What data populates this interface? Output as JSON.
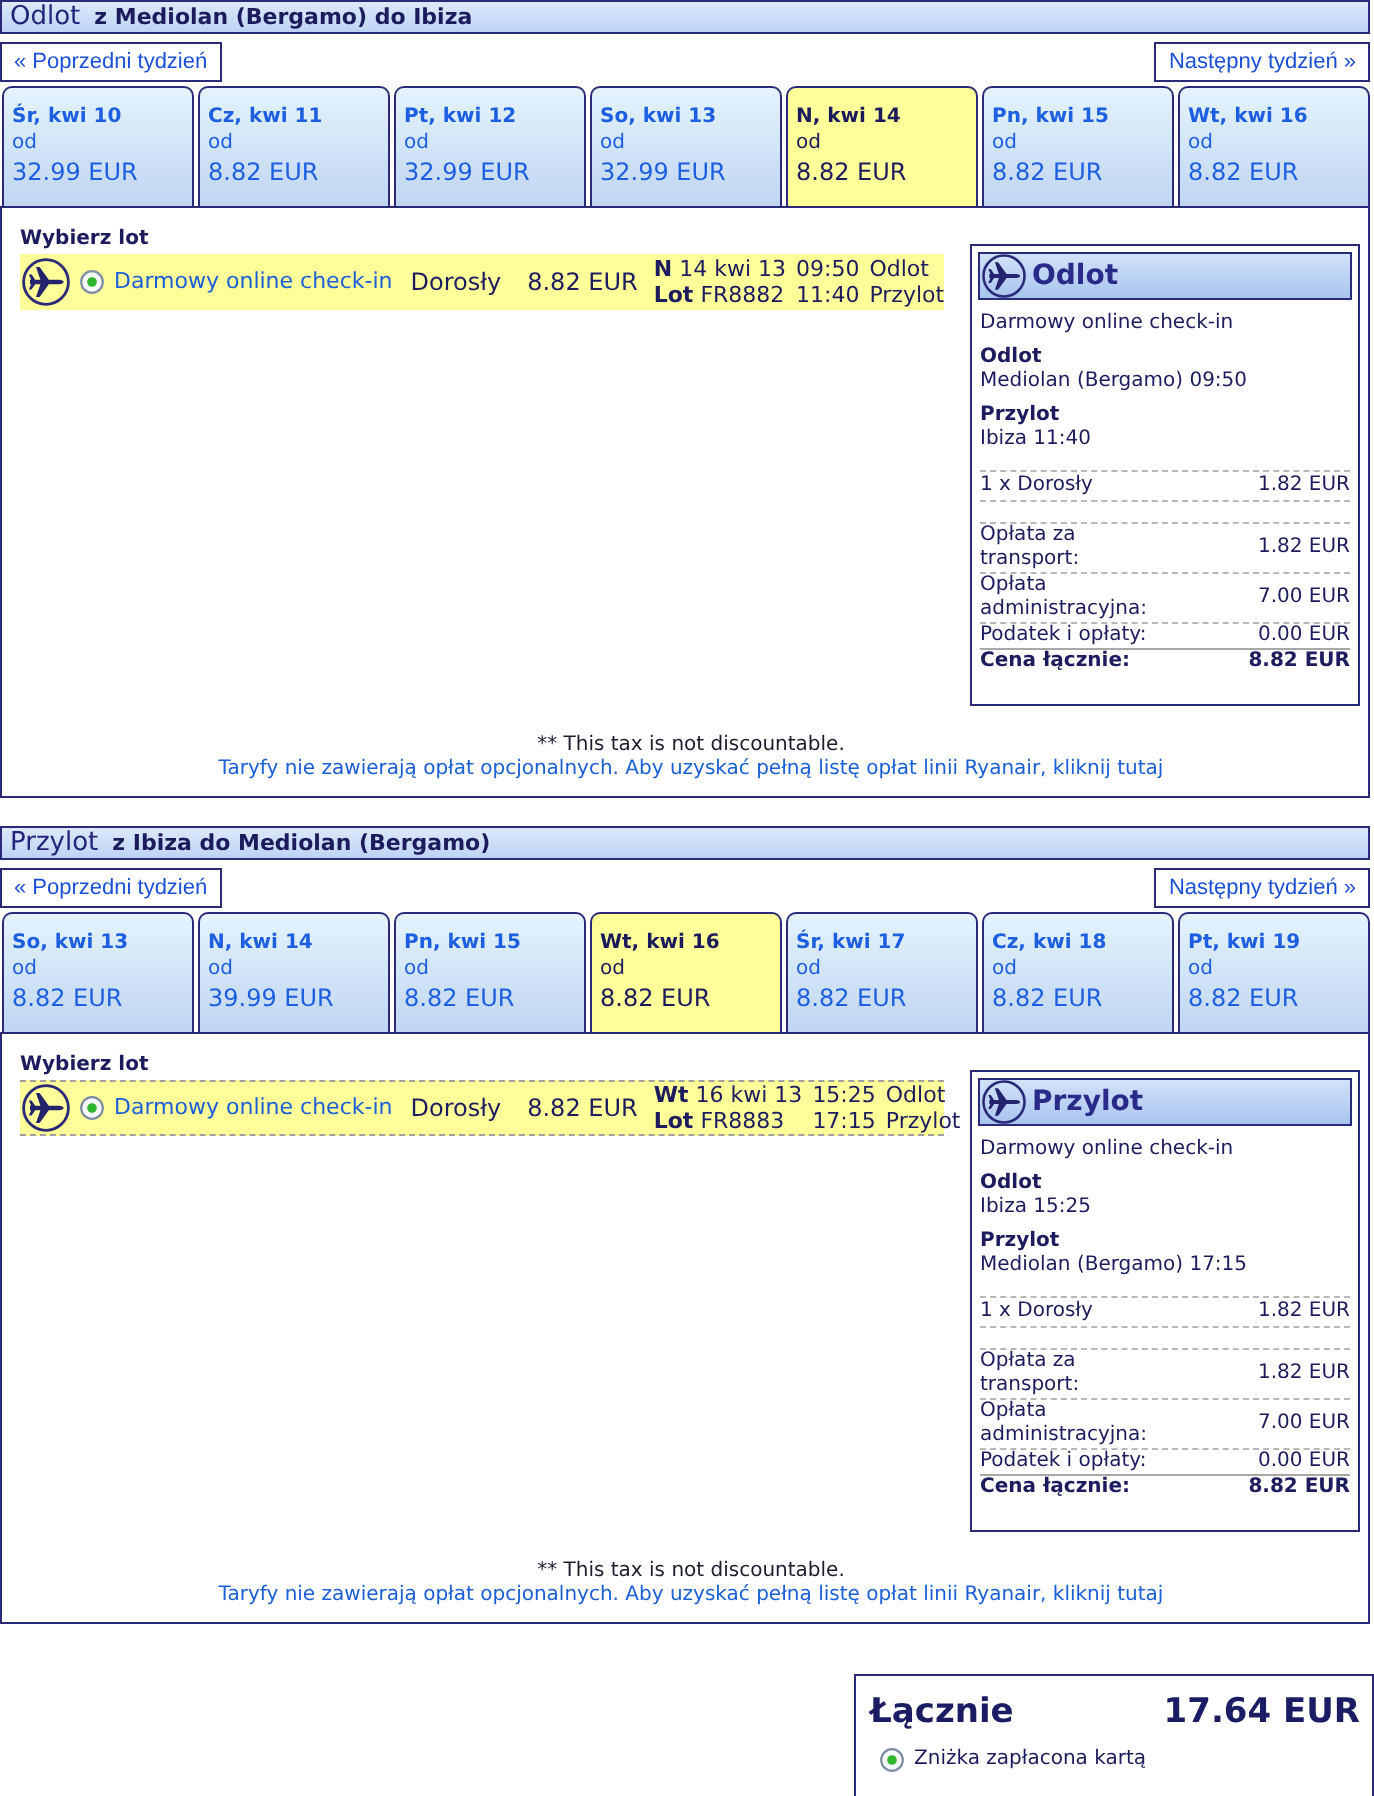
{
  "sections": [
    {
      "title": "Odlot",
      "route": "z Mediolan (Bergamo) do Ibiza",
      "prev_week": "« Poprzedni tydzień",
      "next_week": "Następny tydzień »",
      "days": [
        {
          "day": "Śr, kwi 10",
          "from": "od",
          "price": "32.99 EUR",
          "selected": false
        },
        {
          "day": "Cz, kwi 11",
          "from": "od",
          "price": "8.82 EUR",
          "selected": false
        },
        {
          "day": "Pt, kwi 12",
          "from": "od",
          "price": "32.99 EUR",
          "selected": false
        },
        {
          "day": "So, kwi 13",
          "from": "od",
          "price": "32.99 EUR",
          "selected": false
        },
        {
          "day": "N, kwi 14",
          "from": "od",
          "price": "8.82 EUR",
          "selected": true
        },
        {
          "day": "Pn, kwi 15",
          "from": "od",
          "price": "8.82 EUR",
          "selected": false
        },
        {
          "day": "Wt, kwi 16",
          "from": "od",
          "price": "8.82 EUR",
          "selected": false
        }
      ],
      "choose_label": "Wybierz lot",
      "flights": [
        {
          "selected": true,
          "focused": false,
          "fare_name": "Darmowy online check-in",
          "passenger": "Dorosły",
          "price": "8.82 EUR",
          "day": "N",
          "date": "14 kwi 13",
          "depart_time": "09:50",
          "depart_label": "Odlot",
          "flight_label": "Lot",
          "flight_no": "FR8882",
          "arrive_time": "11:40",
          "arrive_label": "Przylot"
        }
      ],
      "summary": {
        "title": "Odlot",
        "fare_name": "Darmowy online check-in",
        "depart_heading": "Odlot",
        "depart_value": "Mediolan (Bergamo) 09:50",
        "arrive_heading": "Przylot",
        "arrive_value": "Ibiza 11:40",
        "passenger_line": {
          "label": "1 x Dorosły",
          "amount": "1.82 EUR"
        },
        "fees": [
          {
            "label": "Opłata za transport:",
            "amount": "1.82 EUR"
          },
          {
            "label": "Opłata administracyjna:",
            "amount": "7.00 EUR"
          },
          {
            "label": "Podatek i opłaty:",
            "amount": "0.00 EUR"
          }
        ],
        "total_label": "Cena łącznie:",
        "total": "8.82 EUR"
      },
      "tax_note": "** This tax is not discountable.",
      "fees_link": "Taryfy nie zawierają opłat opcjonalnych. Aby uzyskać pełną listę opłat linii Ryanair, kliknij tutaj"
    },
    {
      "title": "Przylot",
      "route": "z Ibiza do Mediolan (Bergamo)",
      "prev_week": "« Poprzedni tydzień",
      "next_week": "Następny tydzień »",
      "days": [
        {
          "day": "So, kwi 13",
          "from": "od",
          "price": "8.82 EUR",
          "selected": false
        },
        {
          "day": "N, kwi 14",
          "from": "od",
          "price": "39.99 EUR",
          "selected": false
        },
        {
          "day": "Pn, kwi 15",
          "from": "od",
          "price": "8.82 EUR",
          "selected": false
        },
        {
          "day": "Wt, kwi 16",
          "from": "od",
          "price": "8.82 EUR",
          "selected": true
        },
        {
          "day": "Śr, kwi 17",
          "from": "od",
          "price": "8.82 EUR",
          "selected": false
        },
        {
          "day": "Cz, kwi 18",
          "from": "od",
          "price": "8.82 EUR",
          "selected": false
        },
        {
          "day": "Pt, kwi 19",
          "from": "od",
          "price": "8.82 EUR",
          "selected": false
        }
      ],
      "choose_label": "Wybierz lot",
      "flights": [
        {
          "selected": true,
          "focused": true,
          "fare_name": "Darmowy online check-in",
          "passenger": "Dorosły",
          "price": "8.82 EUR",
          "day": "Wt",
          "date": "16 kwi 13",
          "depart_time": "15:25",
          "depart_label": "Odlot",
          "flight_label": "Lot",
          "flight_no": "FR8883",
          "arrive_time": "17:15",
          "arrive_label": "Przylot"
        }
      ],
      "summary": {
        "title": "Przylot",
        "fare_name": "Darmowy online check-in",
        "depart_heading": "Odlot",
        "depart_value": "Ibiza 15:25",
        "arrive_heading": "Przylot",
        "arrive_value": "Mediolan (Bergamo) 17:15",
        "passenger_line": {
          "label": "1 x Dorosły",
          "amount": "1.82 EUR"
        },
        "fees": [
          {
            "label": "Opłata za transport:",
            "amount": "1.82 EUR"
          },
          {
            "label": "Opłata administracyjna:",
            "amount": "7.00 EUR"
          },
          {
            "label": "Podatek i opłaty:",
            "amount": "0.00 EUR"
          }
        ],
        "total_label": "Cena łącznie:",
        "total": "8.82 EUR"
      },
      "tax_note": "** This tax is not discountable.",
      "fees_link": "Taryfy nie zawierają opłat opcjonalnych. Aby uzyskać pełną listę opłat linii Ryanair, kliknij tutaj"
    }
  ],
  "grand_total": {
    "label": "Łącznie",
    "amount": "17.64 EUR",
    "discount": {
      "checked": true,
      "label": "Zniżka zapłacona kartą"
    }
  }
}
